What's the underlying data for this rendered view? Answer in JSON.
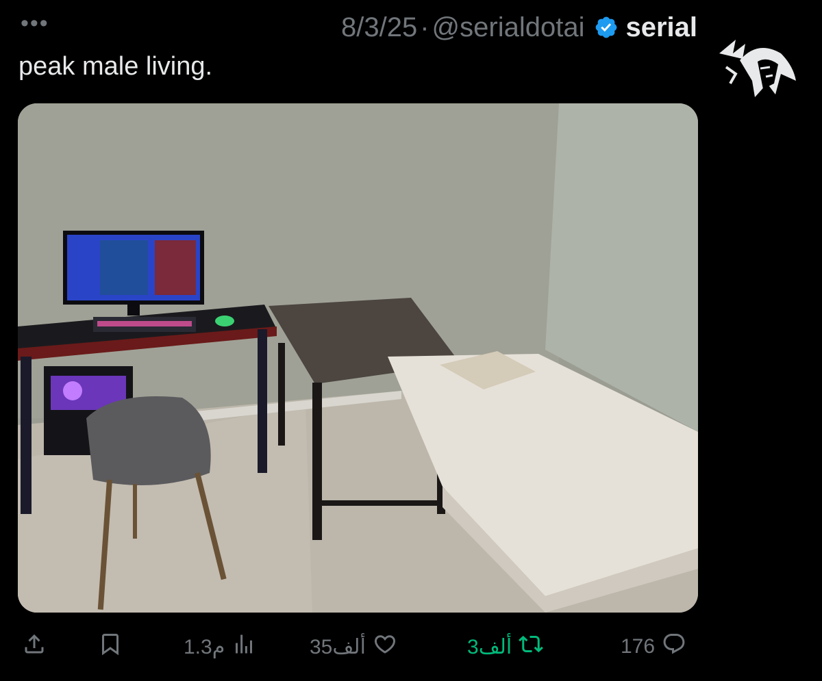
{
  "header": {
    "more_label": "•••",
    "date": "8/3/25",
    "separator": "·",
    "handle": "@serialdotai",
    "display_name": "serial",
    "verified_icon": "verified-badge-icon"
  },
  "tweet": {
    "text": "peak male living.",
    "image_alt": "room-photo"
  },
  "actions": {
    "share_icon": "share-icon",
    "bookmark_icon": "bookmark-icon",
    "views": "م1.3",
    "likes": "35ألف",
    "reposts": "3ألف",
    "replies": "176"
  },
  "colors": {
    "background": "#000000",
    "text": "#e7e9ea",
    "muted": "#71767b",
    "verified": "#1d9bf0",
    "repost_active": "#00ba7c"
  }
}
